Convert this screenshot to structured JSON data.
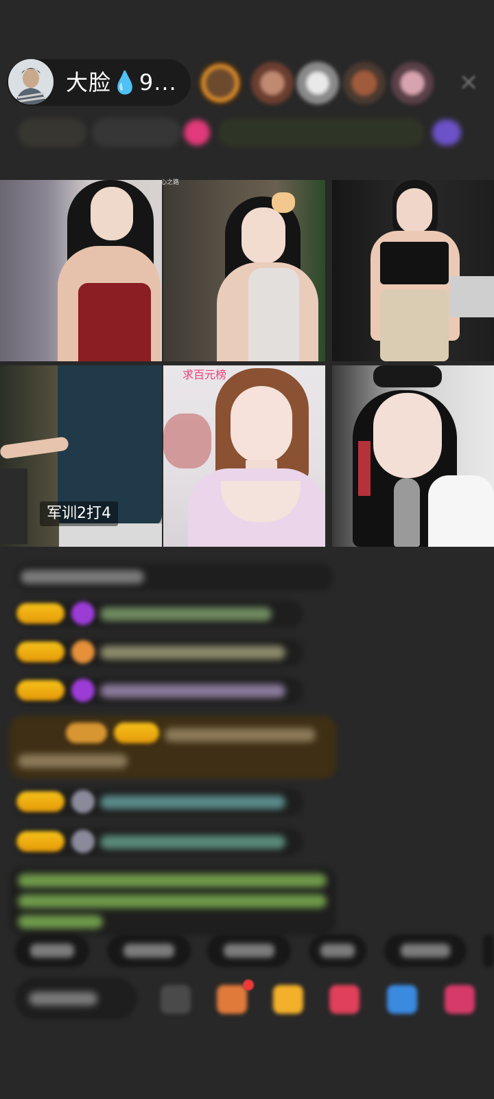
{
  "header": {
    "host_name": "大脸💧9..."
  },
  "grid": {
    "tile_captions": {
      "tile4": "军训2打4",
      "tile5_tag": "求百元榜",
      "tile2_tag": "心之路"
    }
  },
  "colors": {
    "background": "#282828",
    "badge_gold": "#f6c21a",
    "pink_tag": "#ef3d78"
  }
}
